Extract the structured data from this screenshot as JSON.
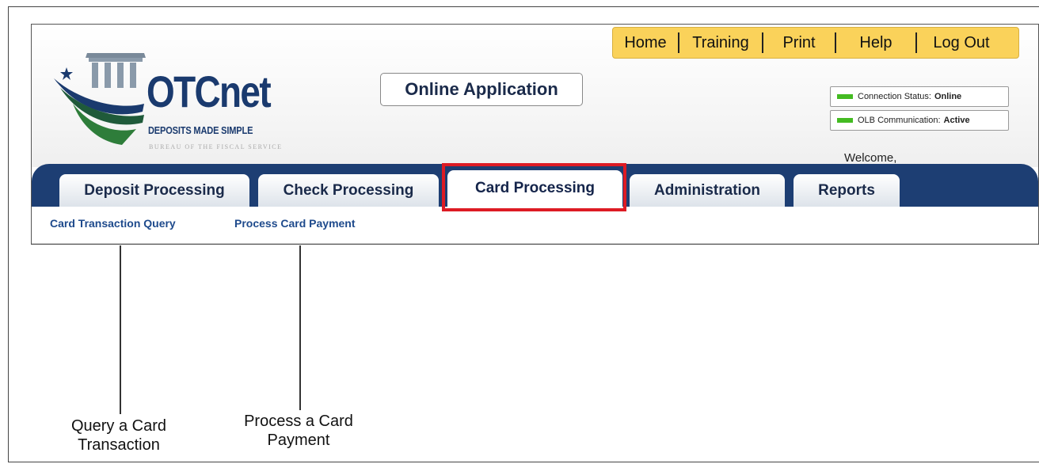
{
  "top_nav": {
    "items": [
      "Home",
      "Training",
      "Print",
      "Help",
      "Log Out"
    ]
  },
  "branding": {
    "logo_text": "OTCnet",
    "tagline": "DEPOSITS MADE SIMPLE",
    "bureau": "BUREAU OF THE FISCAL SERVICE"
  },
  "header": {
    "online_application": "Online Application",
    "welcome": "Welcome,"
  },
  "status": {
    "connection_label": "Connection Status:",
    "connection_value": "Online",
    "olb_label": "OLB Communication:",
    "olb_value": "Active",
    "indicator_color": "#44bb22"
  },
  "tabs": [
    {
      "label": "Deposit Processing"
    },
    {
      "label": "Check Processing"
    },
    {
      "label": "Card Processing",
      "active": true
    },
    {
      "label": "Administration"
    },
    {
      "label": "Reports"
    }
  ],
  "subnav": {
    "items": [
      "Card Transaction Query",
      "Process Card Payment"
    ]
  },
  "annotations": {
    "query": [
      "Query a Card",
      "Transaction"
    ],
    "process": [
      "Process a Card",
      "Payment"
    ]
  },
  "colors": {
    "tab_band": "#1d3e73",
    "highlight": "#dd1b24",
    "top_nav_bg": "#fad25a",
    "link": "#1e4a8c"
  }
}
